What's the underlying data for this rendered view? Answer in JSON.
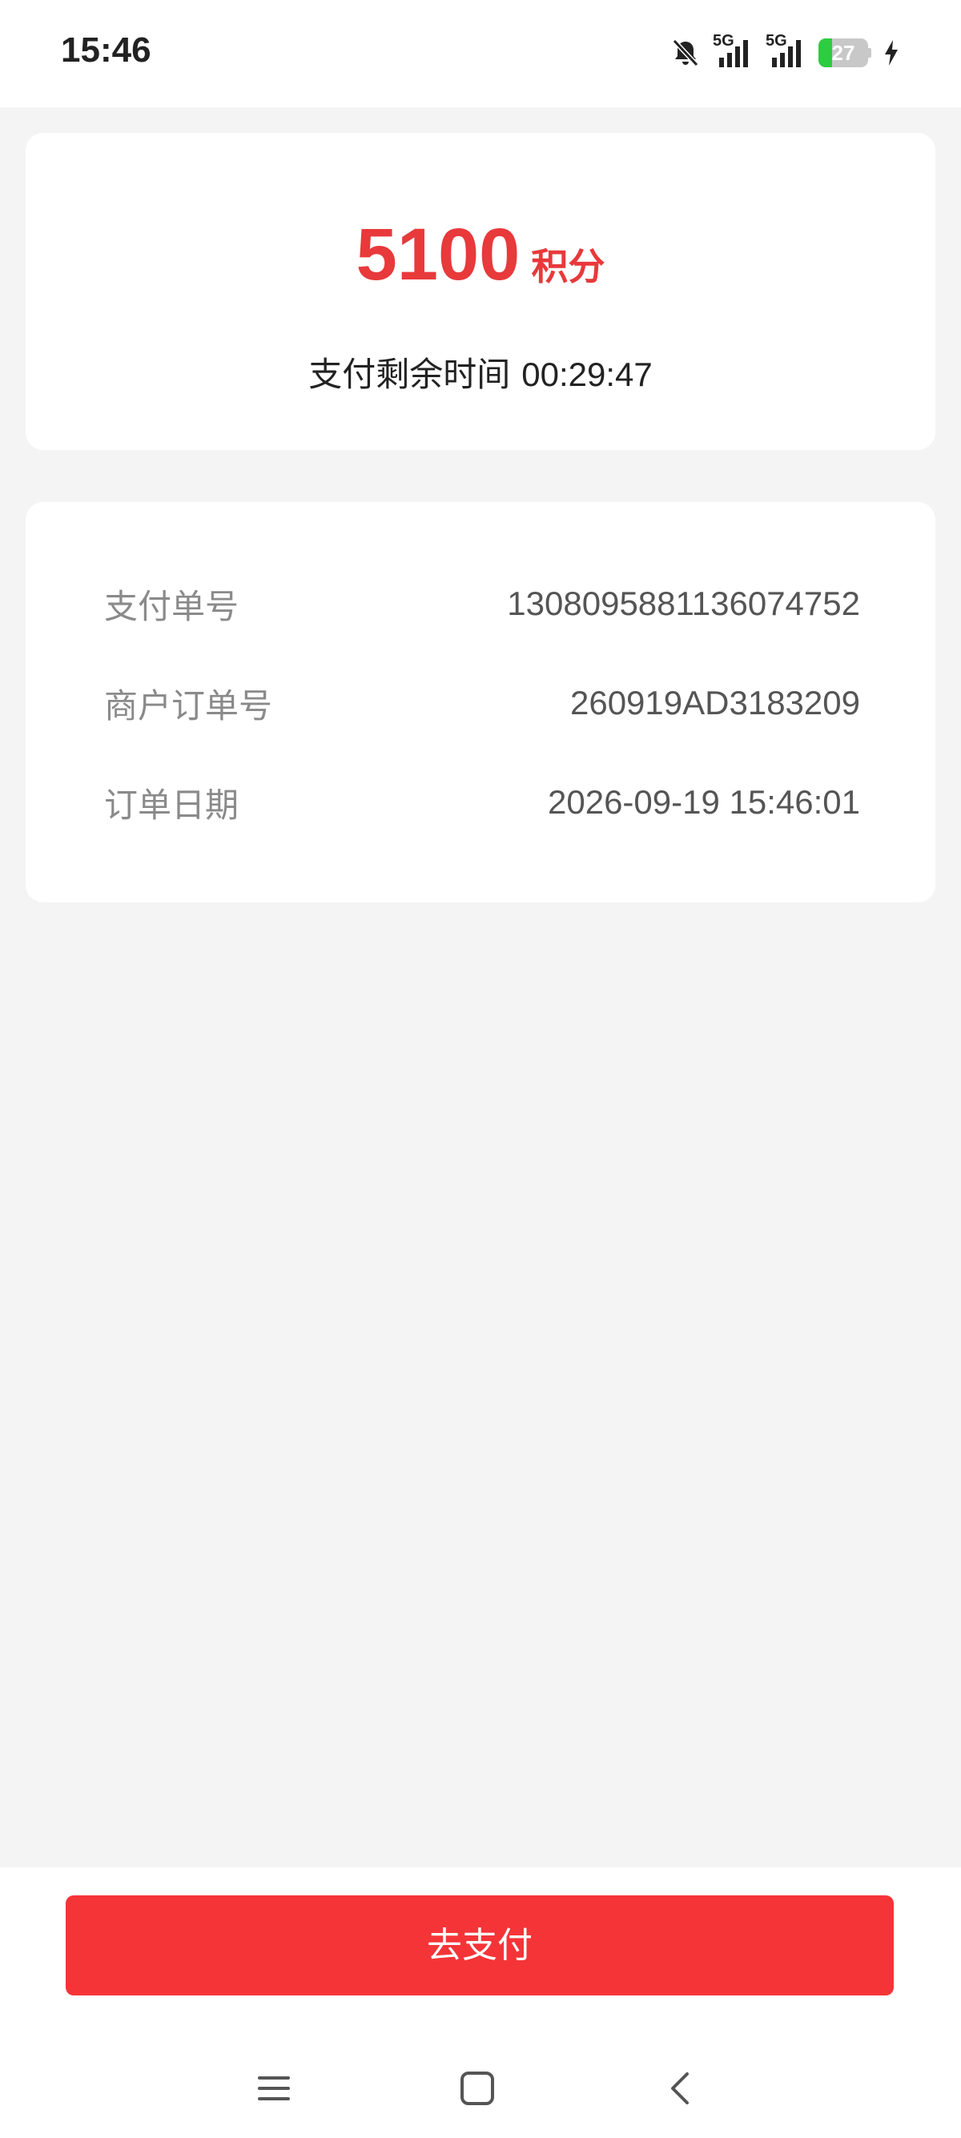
{
  "status_bar": {
    "time": "15:46",
    "network_1": "5G",
    "network_2": "5G",
    "battery_level": "27",
    "battery_fraction": 0.27,
    "icons": [
      "bell-off-icon",
      "signal-icon",
      "signal-icon",
      "battery-icon",
      "charging-icon"
    ]
  },
  "payment": {
    "amount": "5100",
    "unit": "积分",
    "countdown_label": "支付剩余时间",
    "countdown": "00:29:47"
  },
  "details": [
    {
      "label": "支付单号",
      "value": "1308095881136074752"
    },
    {
      "label": "商户订单号",
      "value": "260919AD3183209"
    },
    {
      "label": "订单日期",
      "value": "2026-09-19 15:46:01"
    }
  ],
  "actions": {
    "pay_label": "去支付"
  },
  "nav": {
    "icons": [
      "menu-icon",
      "home-icon",
      "back-icon"
    ]
  },
  "colors": {
    "accent": "#e8393b",
    "button": "#f53438",
    "background": "#f4f4f4",
    "battery": "#2ecc40"
  }
}
